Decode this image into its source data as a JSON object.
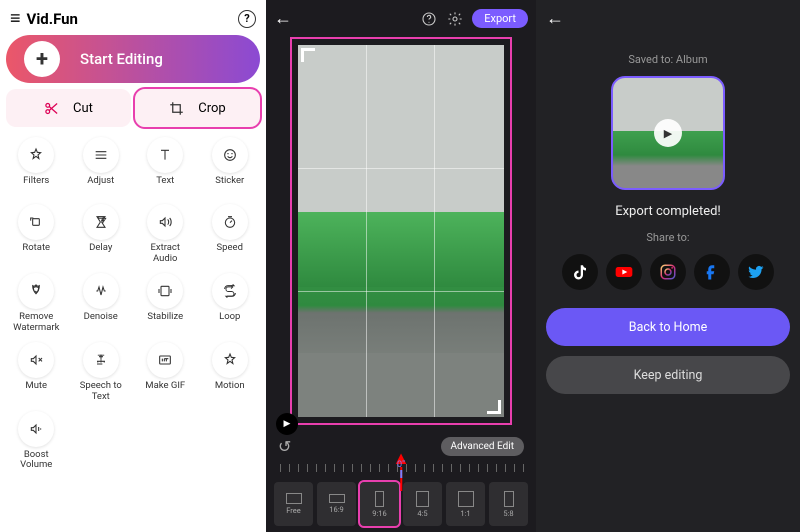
{
  "left": {
    "app_title": "Vid.Fun",
    "start_label": "Start Editing",
    "cut_label": "Cut",
    "crop_label": "Crop",
    "tools": [
      {
        "id": "filters",
        "label": "Filters"
      },
      {
        "id": "adjust",
        "label": "Adjust"
      },
      {
        "id": "text",
        "label": "Text"
      },
      {
        "id": "sticker",
        "label": "Sticker"
      },
      {
        "id": "rotate",
        "label": "Rotate"
      },
      {
        "id": "delay",
        "label": "Delay"
      },
      {
        "id": "extract-audio",
        "label": "Extract\nAudio"
      },
      {
        "id": "speed",
        "label": "Speed"
      },
      {
        "id": "remove-watermark",
        "label": "Remove\nWatermark"
      },
      {
        "id": "denoise",
        "label": "Denoise"
      },
      {
        "id": "stabilize",
        "label": "Stabilize"
      },
      {
        "id": "loop",
        "label": "Loop"
      },
      {
        "id": "mute",
        "label": "Mute"
      },
      {
        "id": "speech-to-text",
        "label": "Speech to\nText"
      },
      {
        "id": "make-gif",
        "label": "Make GIF"
      },
      {
        "id": "motion",
        "label": "Motion"
      },
      {
        "id": "boost-volume",
        "label": "Boost\nVolume"
      }
    ]
  },
  "mid": {
    "export_label": "Export",
    "advanced_label": "Advanced Edit",
    "timeline_position": "0\"",
    "ratios": [
      {
        "id": "free",
        "label": "Free",
        "w": 14,
        "h": 10
      },
      {
        "id": "16-9",
        "label": "16:9",
        "w": 16,
        "h": 9
      },
      {
        "id": "9-16",
        "label": "9:16",
        "w": 9,
        "h": 16,
        "highlight": true,
        "brand": "tiktok"
      },
      {
        "id": "4-5",
        "label": "4:5",
        "w": 10,
        "h": 12
      },
      {
        "id": "1-1",
        "label": "1:1",
        "w": 12,
        "h": 12
      },
      {
        "id": "5-8",
        "label": "5:8",
        "w": 10,
        "h": 16
      }
    ]
  },
  "right": {
    "saved_to": "Saved to: Album",
    "completed": "Export completed!",
    "share_to": "Share to:",
    "back_home": "Back to Home",
    "keep_editing": "Keep editing",
    "share_targets": [
      {
        "id": "tiktok",
        "color": "#fff"
      },
      {
        "id": "youtube",
        "color": "#ff0000"
      },
      {
        "id": "instagram",
        "color": "#e1306c"
      },
      {
        "id": "facebook",
        "color": "#1877f2"
      },
      {
        "id": "twitter",
        "color": "#1da1f2"
      }
    ]
  }
}
